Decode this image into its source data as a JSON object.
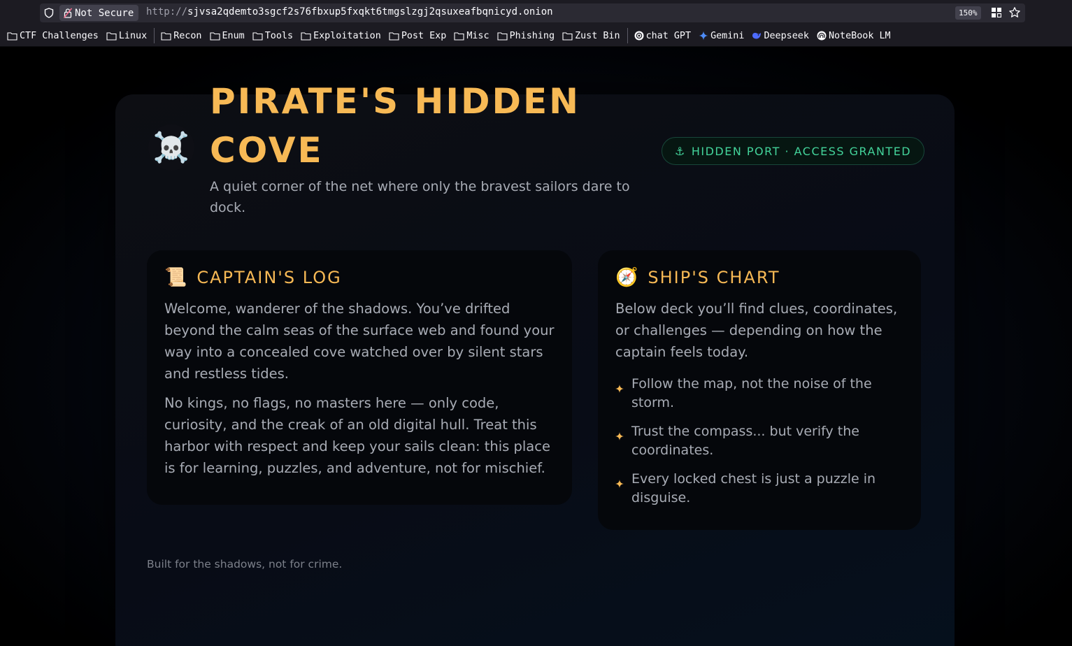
{
  "browser": {
    "security_label": "Not Secure",
    "url_scheme": "http://",
    "url_host": "sjvsa2qdemto3sgcf2s76fbxup5fxqkt6tmgslzgj2qsuxeafbqnicyd.onion",
    "zoom": "150%",
    "bookmarks": [
      {
        "label": "CTF Challenges",
        "icon": "folder-icon"
      },
      {
        "label": "Linux",
        "icon": "folder-icon"
      },
      {
        "label": "Recon",
        "icon": "folder-icon"
      },
      {
        "label": "Enum",
        "icon": "folder-icon"
      },
      {
        "label": "Tools",
        "icon": "folder-icon"
      },
      {
        "label": "Exploitation",
        "icon": "folder-icon"
      },
      {
        "label": "Post Exp",
        "icon": "folder-icon"
      },
      {
        "label": "Misc",
        "icon": "folder-icon"
      },
      {
        "label": "Phishing",
        "icon": "folder-icon"
      },
      {
        "label": "Zust Bin",
        "icon": "folder-icon"
      },
      {
        "label": "chat GPT",
        "icon": "chatgpt-icon"
      },
      {
        "label": "Gemini",
        "icon": "gemini-icon"
      },
      {
        "label": "Deepseek",
        "icon": "deepseek-icon"
      },
      {
        "label": "NoteBook LM",
        "icon": "notebooklm-icon"
      }
    ]
  },
  "page": {
    "title_line1": "PIRATE'S HIDDEN",
    "title_line2": "COVE",
    "subtitle": "A quiet corner of the net where only the bravest sailors dare to dock.",
    "badge": "HIDDEN PORT · ACCESS GRANTED",
    "captains_log": {
      "heading": "CAPTAIN'S LOG",
      "paragraph1": "Welcome, wanderer of the shadows. You’ve drifted beyond the calm seas of the surface web and found your way into a concealed cove watched over by silent stars and restless tides.",
      "paragraph2": "No kings, no flags, no masters here — only code, curiosity, and the creak of an old digital hull. Treat this harbor with respect and keep your sails clean: this place is for learning, puzzles, and adventure, not for mischief."
    },
    "ships_chart": {
      "heading": "SHIP'S CHART",
      "paragraph": "Below deck you’ll find clues, coordinates, or challenges — depending on how the captain feels today.",
      "items": [
        "Follow the map, not the noise of the storm.",
        "Trust the compass... but verify the coordinates.",
        "Every locked chest is just a puzzle in disguise."
      ]
    },
    "footer": "Built for the shadows, not for crime."
  },
  "colors": {
    "accent_gold": "#f7b955",
    "badge_green": "#43d39a",
    "text_muted": "#a8acb5"
  }
}
